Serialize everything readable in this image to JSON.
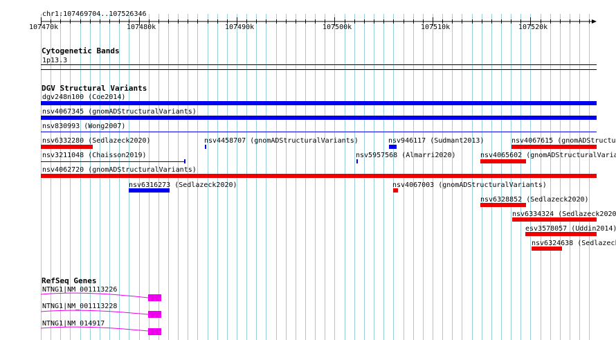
{
  "location": "chr1:107469704..107526346",
  "ruler": {
    "ticks": [
      "107470k",
      "107480k",
      "107490k",
      "107500k",
      "107510k",
      "107520k"
    ]
  },
  "tracks": {
    "cytoband": {
      "title": "Cytogenetic Bands",
      "band": "1p13.3"
    },
    "dgv": {
      "title": "DGV Structural Variants",
      "features": [
        {
          "id": "f1",
          "label": "dgv248n100 (Coe2014)"
        },
        {
          "id": "f2",
          "label": "nsv4067345 (gnomADStructuralVariants)"
        },
        {
          "id": "f3",
          "label": "nsv830993 (Wong2007)"
        },
        {
          "id": "f4",
          "label": "nsv6332280 (Sedlazeck2020)"
        },
        {
          "id": "f5",
          "label": "nsv4458707 (gnomADStructuralVariants)"
        },
        {
          "id": "f6",
          "label": "nsv946117 (Sudmant2013)"
        },
        {
          "id": "f7",
          "label": "nsv4067615 (gnomADStructu"
        },
        {
          "id": "f8",
          "label": "nsv3211048 (Chaisson2019)"
        },
        {
          "id": "f9",
          "label": "nsv5957568 (Almarri2020)"
        },
        {
          "id": "f10",
          "label": "nsv4065602 (gnomADStructuralVaria"
        },
        {
          "id": "f11",
          "label": "nsv4062720 (gnomADStructuralVariants)"
        },
        {
          "id": "f12",
          "label": "nsv6316273 (Sedlazeck2020)"
        },
        {
          "id": "f13",
          "label": "nsv4067003 (gnomADStructuralVariants)"
        },
        {
          "id": "f14",
          "label": "nsv6328852 (Sedlazeck2020)"
        },
        {
          "id": "f15",
          "label": "nsv6334324 (Sedlazeck2020"
        },
        {
          "id": "f16",
          "label": "esv3578057 (Uddin2014)"
        },
        {
          "id": "f17",
          "label": "nsv6324638 (Sedlazeck"
        }
      ]
    },
    "refseq": {
      "title": "RefSeq Genes",
      "genes": [
        {
          "label": "NTNG1|NM_001113226"
        },
        {
          "label": "NTNG1|NM_001113228"
        },
        {
          "label": "NTNG1|NM_014917"
        }
      ]
    }
  },
  "colors": {
    "blue": "#0000ee",
    "red": "#ee0000",
    "magenta": "#ee00ee",
    "grid": "#9ad0dc"
  }
}
